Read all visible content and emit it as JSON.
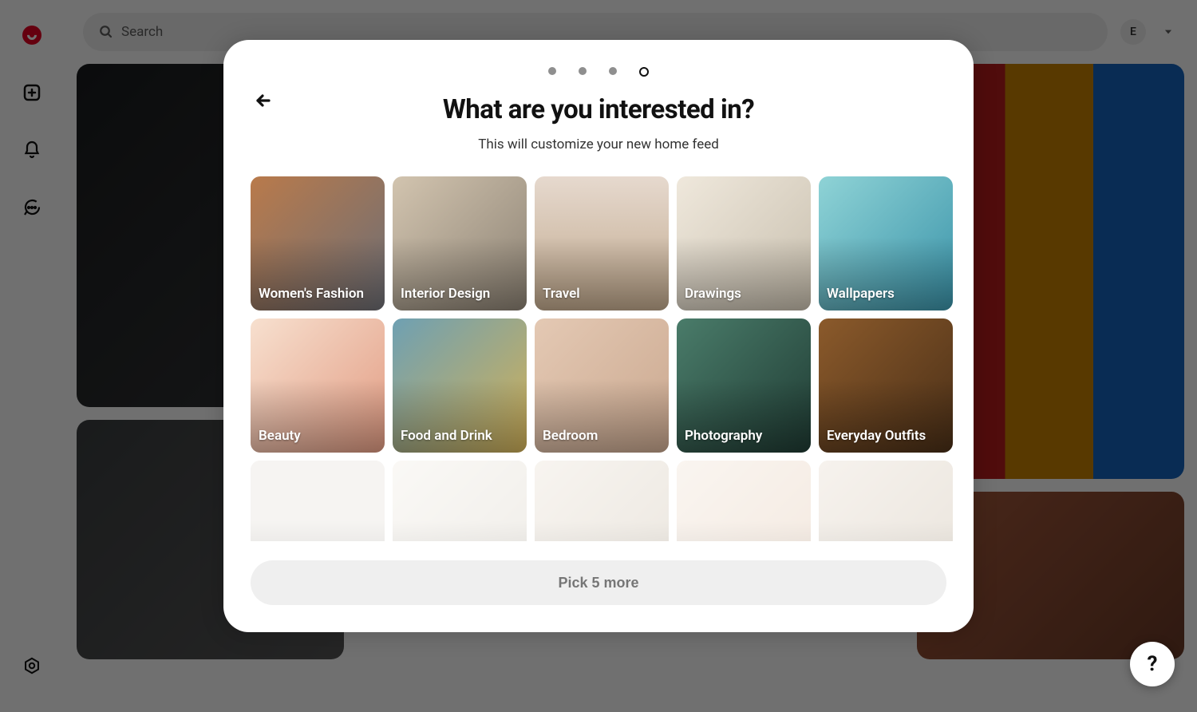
{
  "header": {
    "search_placeholder": "Search",
    "avatar_initial": "E"
  },
  "modal": {
    "title": "What are you interested in?",
    "subtitle": "This will customize your new home feed",
    "cta_label": "Pick 5 more",
    "step_count": 4,
    "active_step_index": 3,
    "interests": [
      {
        "label": "Women's Fashion"
      },
      {
        "label": "Interior Design"
      },
      {
        "label": "Travel"
      },
      {
        "label": "Drawings"
      },
      {
        "label": "Wallpapers"
      },
      {
        "label": "Beauty"
      },
      {
        "label": "Food and Drink"
      },
      {
        "label": "Bedroom"
      },
      {
        "label": "Photography"
      },
      {
        "label": "Everyday Outfits"
      },
      {
        "label": ""
      },
      {
        "label": ""
      },
      {
        "label": ""
      },
      {
        "label": ""
      },
      {
        "label": ""
      }
    ]
  },
  "colors": {
    "brand": "#e60023",
    "cta_disabled_bg": "#efefef",
    "cta_disabled_fg": "#767676"
  },
  "help_label": "?"
}
